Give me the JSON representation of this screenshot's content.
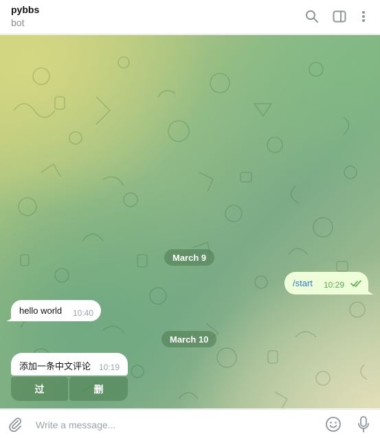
{
  "header": {
    "title": "pybbs",
    "subtitle": "bot",
    "icons": [
      "search-icon",
      "side-panel-icon",
      "more-vertical-icon"
    ]
  },
  "chat": {
    "dates": [
      "March 9",
      "March 10"
    ],
    "messages": [
      {
        "direction": "out",
        "text": "/start",
        "time": "10:29",
        "status": "read"
      },
      {
        "direction": "in",
        "text": "hello world",
        "time": "10:40"
      },
      {
        "direction": "in",
        "text": "添加一条中文评论",
        "time": "10:19"
      }
    ],
    "keyboard": [
      "过",
      "删"
    ]
  },
  "composer": {
    "placeholder": "Write a message...",
    "icons": [
      "attach-icon",
      "emoji-icon",
      "microphone-icon"
    ]
  },
  "colors": {
    "outgoing_bubble": "#eefed9",
    "incoming_bubble": "#ffffff",
    "read_check": "#5aa94f",
    "command_link": "#2f7ec0"
  }
}
